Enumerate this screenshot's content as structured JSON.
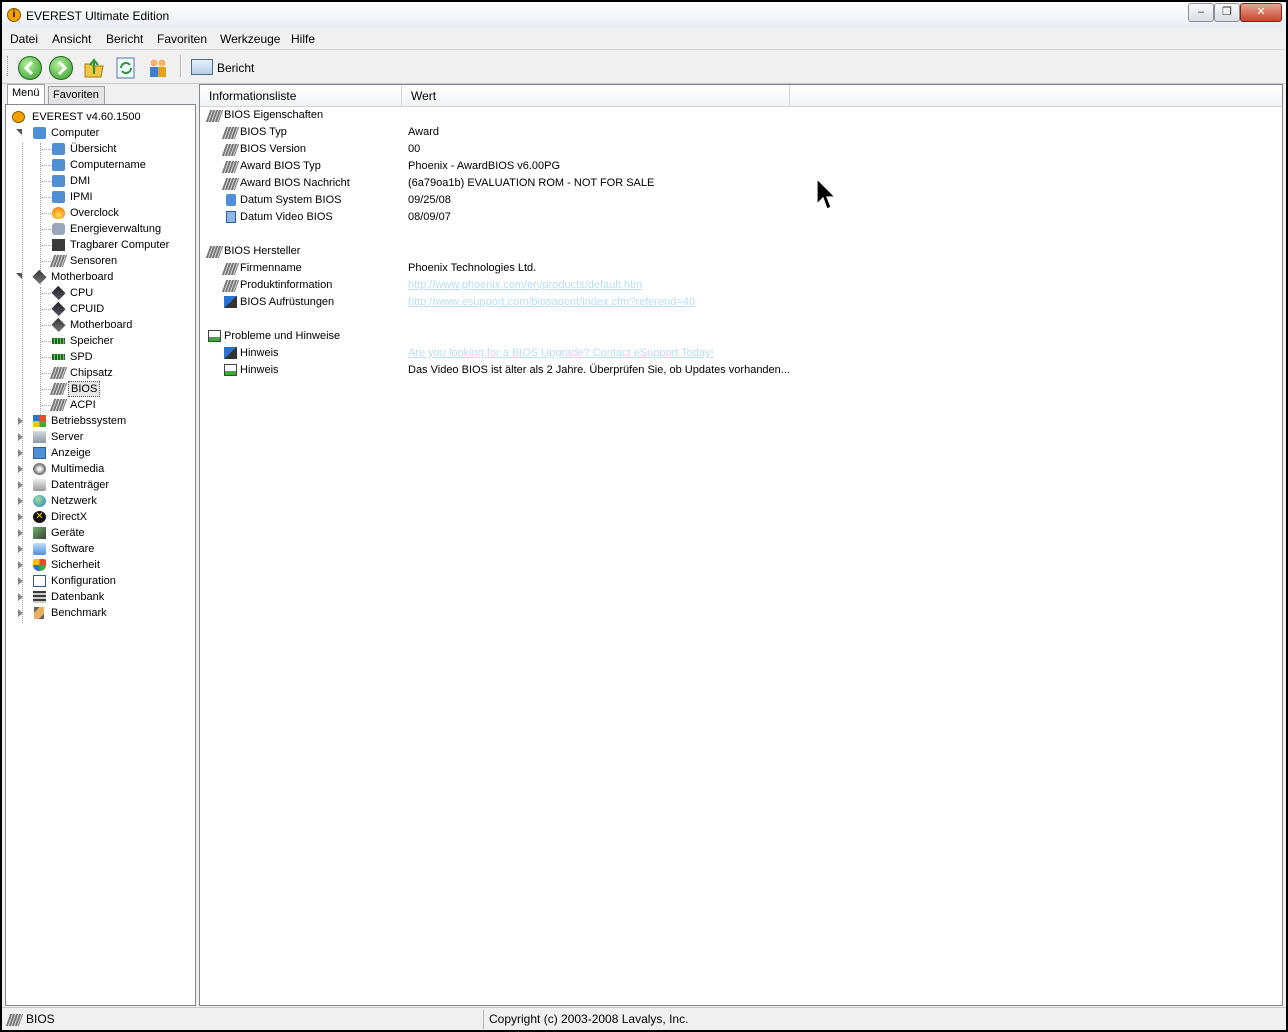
{
  "window": {
    "title": "EVEREST Ultimate Edition",
    "app_icon_glyph": "i"
  },
  "menu": [
    "Datei",
    "Ansicht",
    "Bericht",
    "Favoriten",
    "Werkzeuge",
    "Hilfe"
  ],
  "toolbar": {
    "report_label": "Bericht",
    "buttons": [
      "back-icon",
      "forward-icon",
      "folder-up-icon",
      "refresh-icon",
      "users-icon"
    ]
  },
  "left_tabs": [
    "Menü",
    "Favoriten"
  ],
  "tree": [
    {
      "label": "EVEREST v4.60.1500",
      "icon": "info-icon"
    },
    {
      "label": "Computer",
      "icon": "computer-icon"
    },
    {
      "label": "Übersicht",
      "icon": "computer-icon"
    },
    {
      "label": "Computername",
      "icon": "computer-icon"
    },
    {
      "label": "DMI",
      "icon": "computer-icon"
    },
    {
      "label": "IPMI",
      "icon": "computer-icon"
    },
    {
      "label": "Overclock",
      "icon": "fire-icon"
    },
    {
      "label": "Energieverwaltung",
      "icon": "power-icon"
    },
    {
      "label": "Tragbarer Computer",
      "icon": "laptop-icon"
    },
    {
      "label": "Sensoren",
      "icon": "chip-icon"
    },
    {
      "label": "Motherboard",
      "icon": "motherboard-icon"
    },
    {
      "label": "CPU",
      "icon": "cpu-icon"
    },
    {
      "label": "CPUID",
      "icon": "cpu-icon"
    },
    {
      "label": "Motherboard",
      "icon": "motherboard-icon"
    },
    {
      "label": "Speicher",
      "icon": "memory-icon"
    },
    {
      "label": "SPD",
      "icon": "memory-icon"
    },
    {
      "label": "Chipsatz",
      "icon": "chip-icon"
    },
    {
      "label": "BIOS",
      "icon": "chip-icon"
    },
    {
      "label": "ACPI",
      "icon": "chip-icon"
    },
    {
      "label": "Betriebssystem",
      "icon": "windows-icon"
    },
    {
      "label": "Server",
      "icon": "server-icon"
    },
    {
      "label": "Anzeige",
      "icon": "monitor-icon"
    },
    {
      "label": "Multimedia",
      "icon": "speaker-icon"
    },
    {
      "label": "Datenträger",
      "icon": "disk-icon"
    },
    {
      "label": "Netzwerk",
      "icon": "network-icon"
    },
    {
      "label": "DirectX",
      "icon": "directx-icon"
    },
    {
      "label": "Geräte",
      "icon": "devices-icon"
    },
    {
      "label": "Software",
      "icon": "software-icon"
    },
    {
      "label": "Sicherheit",
      "icon": "shield-icon"
    },
    {
      "label": "Konfiguration",
      "icon": "config-icon"
    },
    {
      "label": "Datenbank",
      "icon": "database-icon"
    },
    {
      "label": "Benchmark",
      "icon": "hourglass-icon"
    }
  ],
  "columns": {
    "field": "Informationsliste",
    "value": "Wert"
  },
  "sections": [
    {
      "title": "BIOS Eigenschaften",
      "icon": "chip-icon",
      "rows": [
        {
          "field": "BIOS Typ",
          "value": "Award",
          "icon": "chip-icon"
        },
        {
          "field": "BIOS Version",
          "value": "00",
          "icon": "chip-icon"
        },
        {
          "field": "Award BIOS Typ",
          "value": "Phoenix - AwardBIOS v6.00PG",
          "icon": "chip-icon"
        },
        {
          "field": "Award BIOS Nachricht",
          "value": "(6a79oa1b) EVALUATION ROM - NOT FOR SALE",
          "icon": "chip-icon"
        },
        {
          "field": "Datum System BIOS",
          "value": "09/25/08",
          "icon": "computer-icon"
        },
        {
          "field": "Datum Video BIOS",
          "value": "08/09/07",
          "icon": "monitor-icon"
        }
      ]
    },
    {
      "title": "BIOS Hersteller",
      "icon": "chip-icon",
      "rows": [
        {
          "field": "Firmenname",
          "value": "Phoenix Technologies Ltd.",
          "icon": "chip-icon"
        },
        {
          "field": "Produktinformation",
          "value": "http://www.phoenix.com/en/products/default.htm",
          "icon": "chip-icon",
          "link": true
        },
        {
          "field": "BIOS Aufrüstungen",
          "value": "http://www.esupport.com/biosagent/index.cfm?refererid=40",
          "icon": "upgrade-icon",
          "link": true
        }
      ]
    },
    {
      "title": "Probleme und Hinweise",
      "icon": "notice-icon",
      "rows": [
        {
          "field": "Hinweis",
          "value": "Are you looking for a BIOS Upgrade?  Contact eSupport Today!",
          "icon": "upgrade-icon",
          "link": true
        },
        {
          "field": "Hinweis",
          "value": "Das Video BIOS ist älter als 2 Jahre. Überprüfen Sie, ob Updates vorhanden...",
          "icon": "notice-icon"
        }
      ]
    }
  ],
  "status": {
    "left": "BIOS",
    "right": "Copyright (c) 2003-2008 Lavalys, Inc."
  },
  "colors": {
    "link": "#b9dff0",
    "accent_orange": "#f6a100",
    "nav_green": "#3bb54a"
  }
}
